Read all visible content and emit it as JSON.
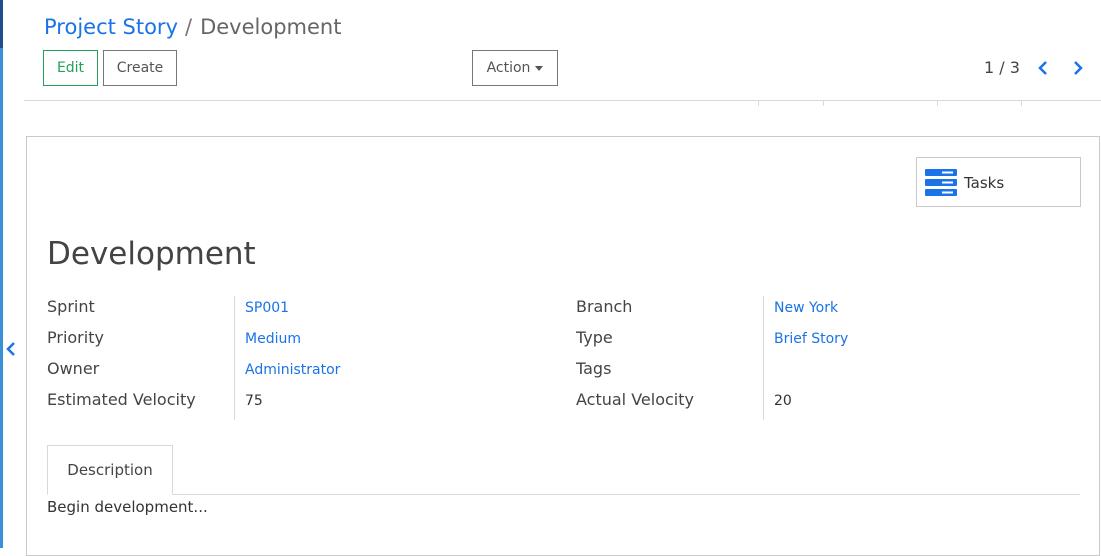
{
  "breadcrumb": {
    "parent": "Project Story",
    "separator": "/",
    "current": "Development"
  },
  "toolbar": {
    "edit_label": "Edit",
    "create_label": "Create",
    "action_label": "Action"
  },
  "pager": {
    "value": "1 / 3"
  },
  "smart_button": {
    "label": "Tasks",
    "icon": "server-stack-icon"
  },
  "record": {
    "title": "Development",
    "fields_left": [
      {
        "label": "Sprint",
        "value": "SP001"
      },
      {
        "label": "Priority",
        "value": "Medium"
      },
      {
        "label": "Owner",
        "value": "Administrator"
      },
      {
        "label": "Estimated Velocity",
        "value": "75"
      }
    ],
    "fields_right": [
      {
        "label": "Branch",
        "value": "New York"
      },
      {
        "label": "Type",
        "value": "Brief Story"
      },
      {
        "label": "Tags",
        "value": ""
      },
      {
        "label": "Actual Velocity",
        "value": "20"
      }
    ]
  },
  "tabs": [
    {
      "label": "Description"
    }
  ],
  "description": "Begin development...",
  "colors": {
    "link": "#1a73e8",
    "edit_button": "#22a05a",
    "smart_icon": "#1a73e8"
  }
}
